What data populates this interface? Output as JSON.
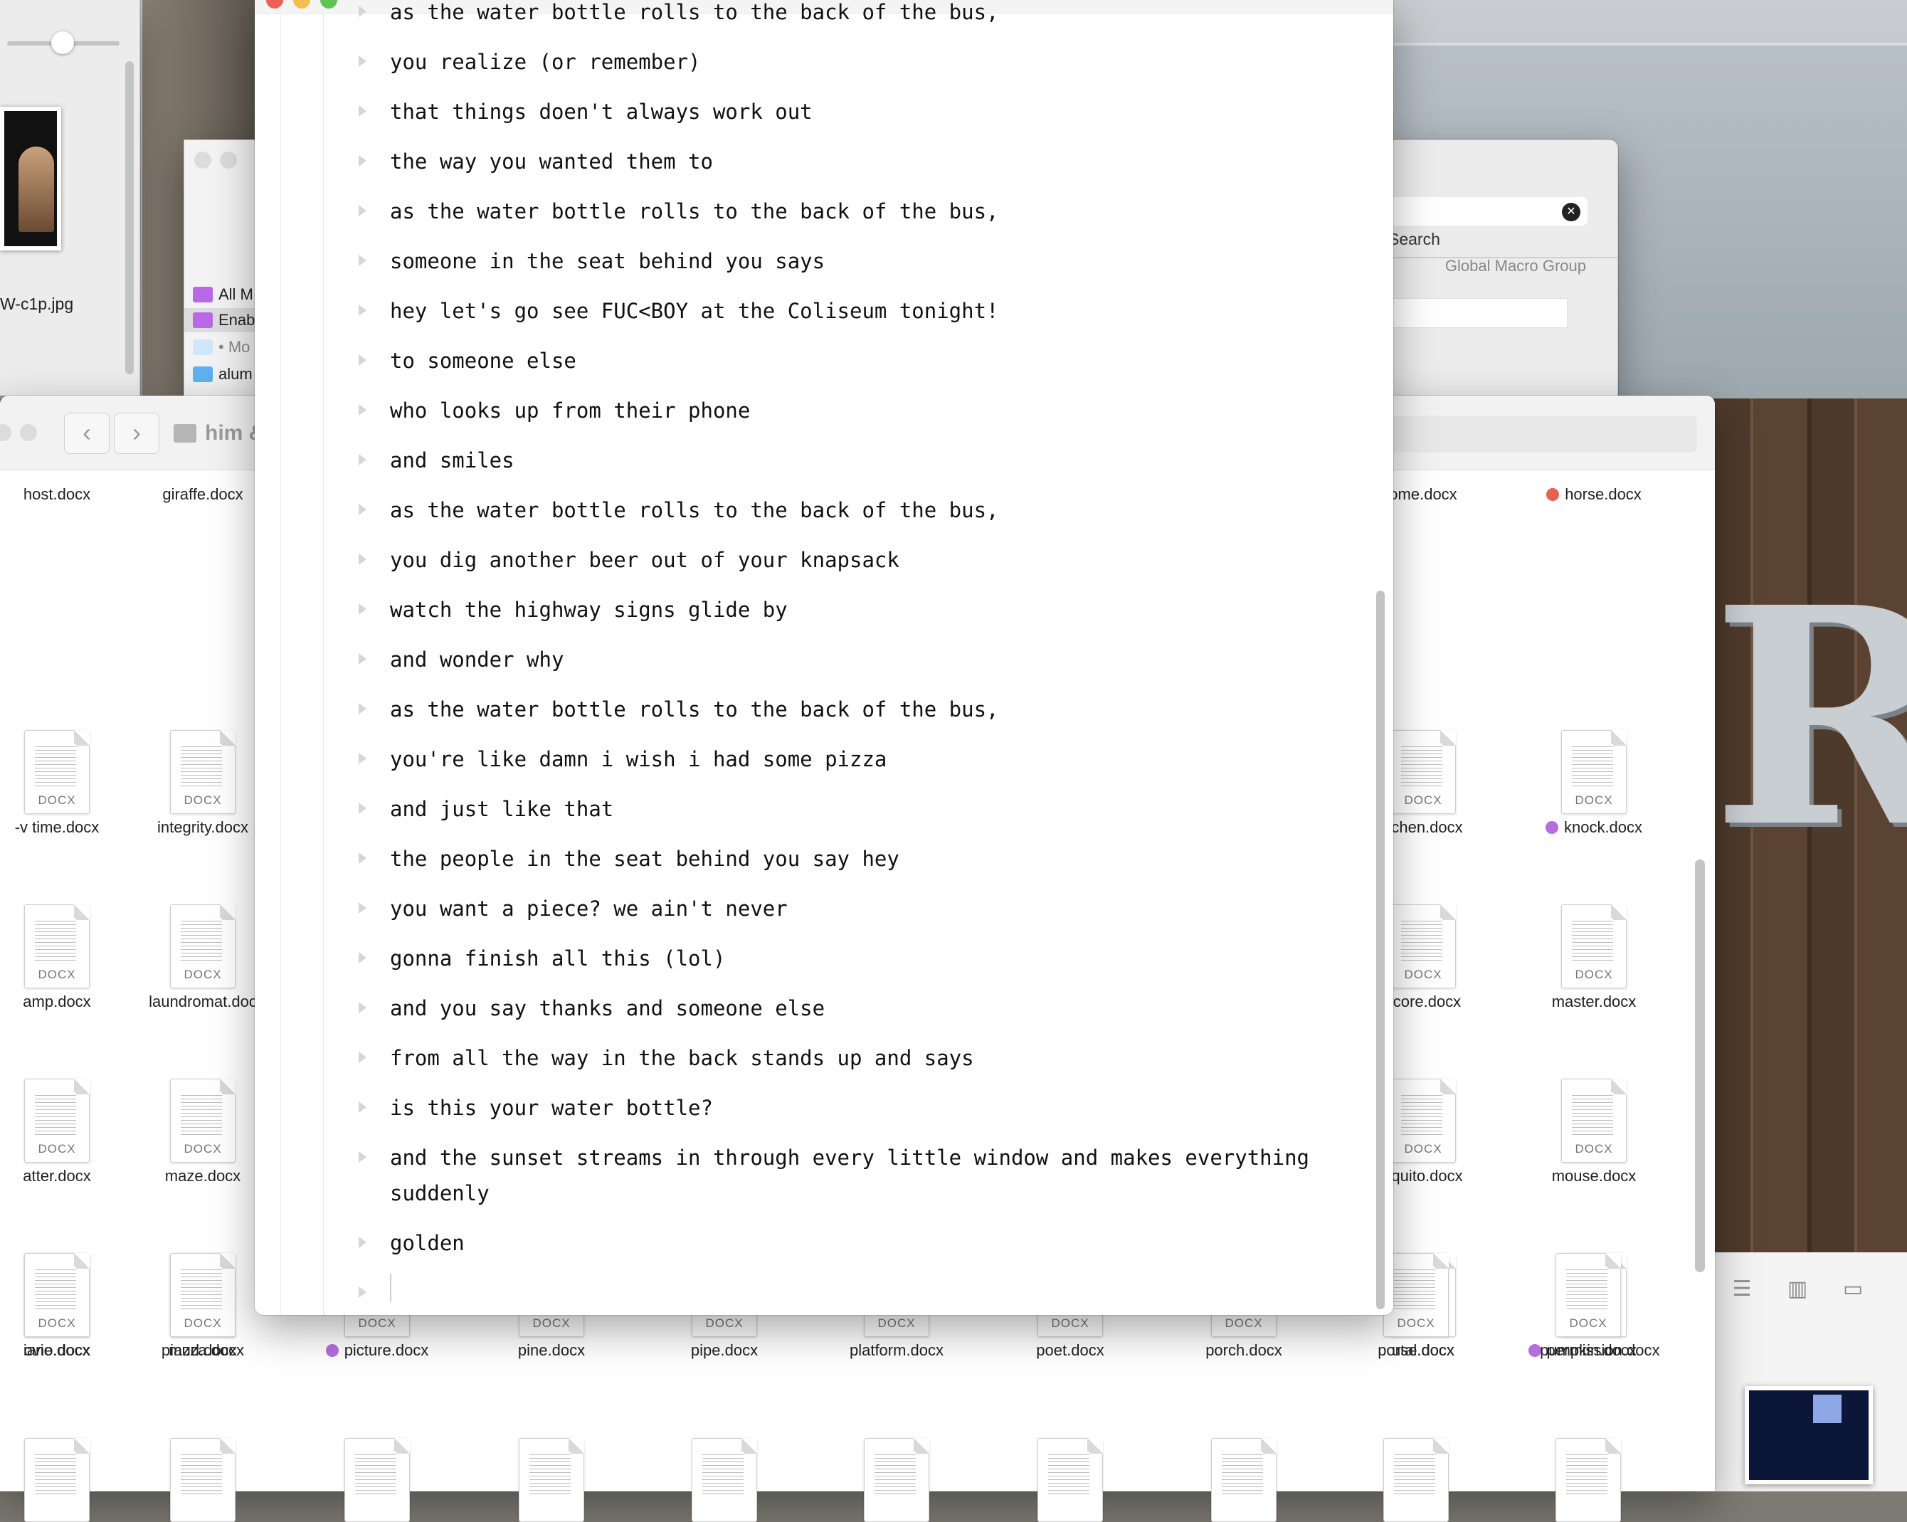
{
  "preview_window": {
    "filename": "W-c1p.jpg"
  },
  "sidebar_window": {
    "items": [
      {
        "label": "All M",
        "icon": "smart-folder-icon"
      },
      {
        "label": "Enab",
        "icon": "smart-folder-icon"
      },
      {
        "label": "• Mo",
        "icon": "folder-icon"
      },
      {
        "label": "alum",
        "icon": "folder-icon"
      }
    ]
  },
  "search_window": {
    "search_label": "Search",
    "group_label": "Global Macro Group"
  },
  "finder": {
    "title": "him &",
    "tag_colors": {
      "red": "#e8604f",
      "purple": "#b46ee0"
    },
    "files": [
      {
        "name": "host.docx"
      },
      {
        "name": "giraffe.docx"
      },
      {
        "name": "ome.docx"
      },
      {
        "name": "horse.docx",
        "tag": "red"
      },
      {
        "name": "-v time.docx"
      },
      {
        "name": "integrity.docx"
      },
      {
        "name": "itchen.docx"
      },
      {
        "name": "knock.docx",
        "tag": "purple"
      },
      {
        "name": "amp.docx"
      },
      {
        "name": "laundromat.doc"
      },
      {
        "name": "ticore.docx"
      },
      {
        "name": "master.docx"
      },
      {
        "name": "atter.docx"
      },
      {
        "name": "maze.docx"
      },
      {
        "name": "squito.docx"
      },
      {
        "name": "mouse.docx"
      },
      {
        "name": "ovie.docx"
      },
      {
        "name": "mud.docx"
      },
      {
        "name": "use.docx"
      },
      {
        "name": "permission.docx",
        "tag": "purple"
      },
      {
        "name": "iano.docx"
      },
      {
        "name": "piazza.docx"
      },
      {
        "name": "picture.docx",
        "tag": "purple"
      },
      {
        "name": "pine.docx"
      },
      {
        "name": "pipe.docx"
      },
      {
        "name": "platform.docx"
      },
      {
        "name": "poet.docx"
      },
      {
        "name": "porch.docx"
      },
      {
        "name": "portal.docx"
      },
      {
        "name": "pumpkin.docx"
      }
    ],
    "doc_type": "DOCX"
  },
  "editor": {
    "lines": [
      "as the water bottle rolls to the back of the bus,",
      "you realize (or remember)",
      "that things doen't always work out",
      "the way you wanted them to",
      "as the water bottle rolls to the back of the bus,",
      "someone in the seat behind you says",
      "hey let's go see FUC<BOY at the Coliseum tonight!",
      "to someone else",
      "who looks up from their phone",
      "and smiles",
      "as the water bottle rolls to the back of the bus,",
      "you dig another beer out of your knapsack",
      "watch the highway signs glide by",
      "and wonder why",
      "as the water bottle rolls to the back of the bus,",
      "you're like damn i wish i had some pizza",
      "and just like that",
      "the people in the seat behind you say hey",
      "you want a piece? we ain't never",
      "gonna finish all this (lol)",
      "and you say thanks and someone else",
      "from all the way in the back stands up and says",
      "is this your water bottle?",
      "and the sunset streams in through every little window and makes everything suddenly",
      "golden",
      ""
    ]
  }
}
